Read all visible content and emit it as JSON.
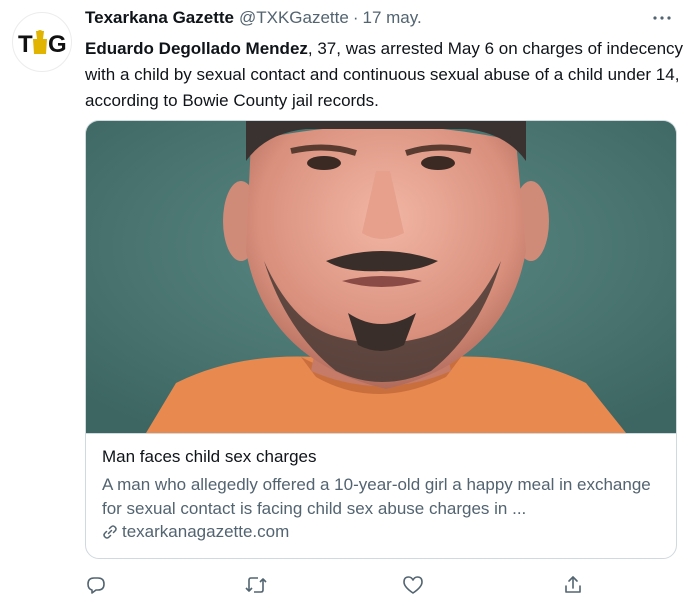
{
  "account": {
    "avatar_text": "TXG",
    "name": "Texarkana Gazette",
    "handle": "@TXKGazette",
    "separator": "·",
    "date": "17 may."
  },
  "tweet": {
    "bold_name": "Eduardo Degollado Mendez",
    "text_rest": ", 37, was arrested May 6 on charges of indecency with a child by sexual contact and continuous sexual abuse of a child under 14, according to Bowie County jail records."
  },
  "card": {
    "title": "Man faces child sex charges",
    "description": "A man who allegedly offered a 10-year-old girl a happy meal in exchange for sexual contact is facing child sex abuse charges in ...",
    "domain": "texarkanagazette.com"
  },
  "actions": [
    "reply-icon",
    "retweet-icon",
    "like-icon",
    "share-icon"
  ],
  "colors": {
    "text": "#0f1419",
    "secondary": "#536471",
    "border": "#cfd9de",
    "photo_background": "#4f7d78",
    "shirt": "#e8894f"
  }
}
